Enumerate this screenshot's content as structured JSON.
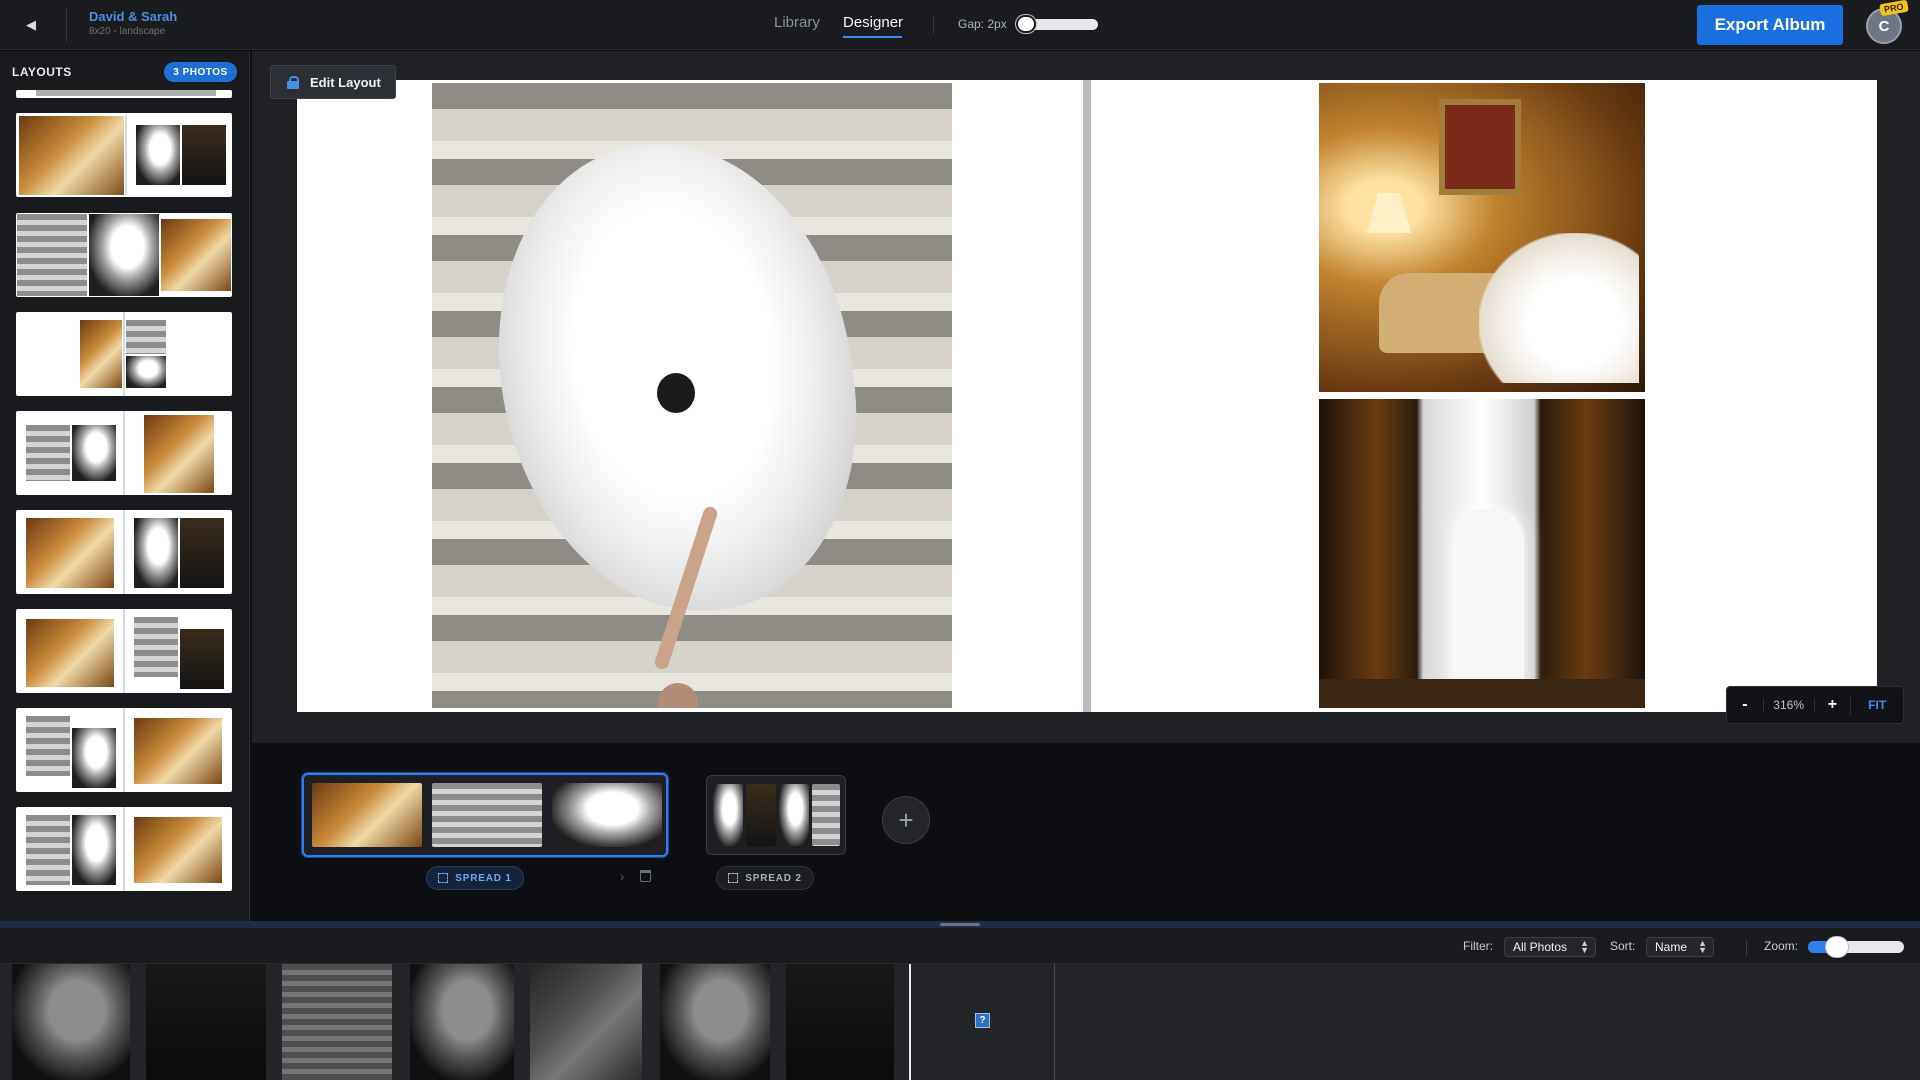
{
  "header": {
    "back_icon": "back-arrow-icon",
    "album_title": "David & Sarah",
    "album_subtitle": "8x20 - landscape",
    "tabs": [
      {
        "label": "Library",
        "active": false
      },
      {
        "label": "Designer",
        "active": true
      }
    ],
    "gap_label": "Gap: 2px",
    "export_label": "Export Album",
    "avatar_initial": "C",
    "pro_badge": "PRO"
  },
  "sidebar": {
    "title": "LAYOUTS",
    "photo_count_badge": "3 PHOTOS",
    "layout_count": 8
  },
  "canvas": {
    "edit_layout_label": "Edit Layout",
    "zoom": {
      "minus": "-",
      "value": "316%",
      "plus": "+",
      "fit": "FIT"
    }
  },
  "spreads": [
    {
      "label": "SPREAD 1",
      "selected": true,
      "photos": 3
    },
    {
      "label": "SPREAD 2",
      "selected": false,
      "photos": 4
    }
  ],
  "add_spread_icon": "plus-icon",
  "tray": {
    "filter_label": "Filter:",
    "filter_value": "All Photos",
    "sort_label": "Sort:",
    "sort_value": "Name",
    "zoom_label": "Zoom:",
    "zoom_level": 0.2
  },
  "colors": {
    "accent": "#1a6fe0",
    "pro_badge": "#f0c419",
    "background": "#0f1013"
  }
}
